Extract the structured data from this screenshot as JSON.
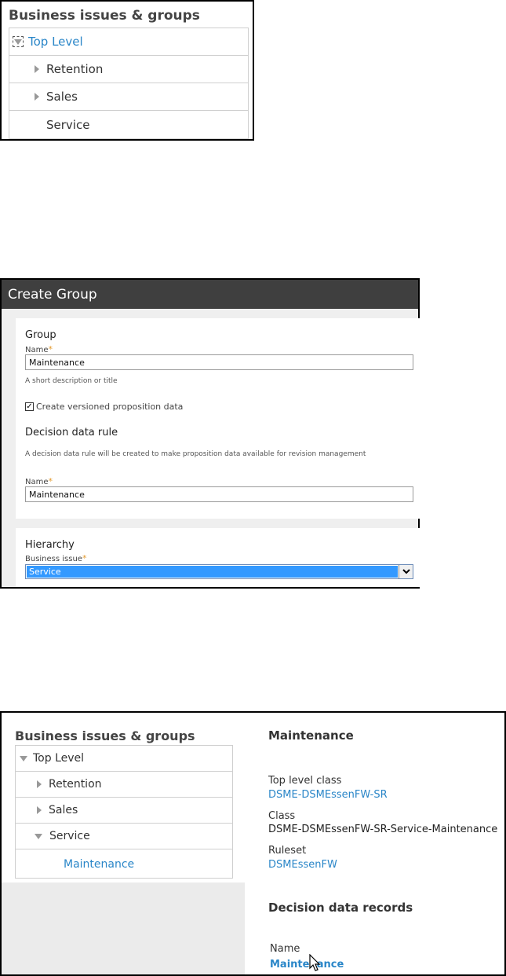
{
  "panel1": {
    "title": "Business issues & groups",
    "tree": [
      {
        "label": "Top Level"
      },
      {
        "label": "Retention"
      },
      {
        "label": "Sales"
      },
      {
        "label": "Service"
      }
    ]
  },
  "panel2": {
    "window_title": "Create Group",
    "group": {
      "heading": "Group",
      "name_label": "Name",
      "name_value": "Maintenance",
      "hint": "A short description or title",
      "checkbox_label": "Create versioned proposition data",
      "checkbox_checked": true
    },
    "decision_rule": {
      "heading": "Decision data rule",
      "description": "A decision data rule will be created to make proposition data available for revision management",
      "name_label": "Name",
      "name_value": "Maintenance"
    },
    "hierarchy": {
      "heading": "Hierarchy",
      "business_issue_label": "Business issue",
      "business_issue_value": "Service"
    },
    "required_marker": "*"
  },
  "panel3": {
    "title": "Business issues & groups",
    "tree": [
      {
        "label": "Top Level"
      },
      {
        "label": "Retention"
      },
      {
        "label": "Sales"
      },
      {
        "label": "Service"
      },
      {
        "label": "Maintenance"
      }
    ],
    "details": {
      "heading": "Maintenance",
      "top_level_class_label": "Top level class",
      "top_level_class_value": "DSME-DSMEssenFW-SR",
      "class_label": "Class",
      "class_value": "DSME-DSMEssenFW-SR-Service-Maintenance",
      "ruleset_label": "Ruleset",
      "ruleset_value": "DSMEssenFW",
      "records_heading": "Decision data records",
      "records_name_label": "Name",
      "records_name_value": "Maintenance"
    }
  },
  "colors": {
    "link": "#2a86c8",
    "header_bg": "#3f3f3f",
    "required": "#e39a2d",
    "selection": "#3399ff"
  }
}
